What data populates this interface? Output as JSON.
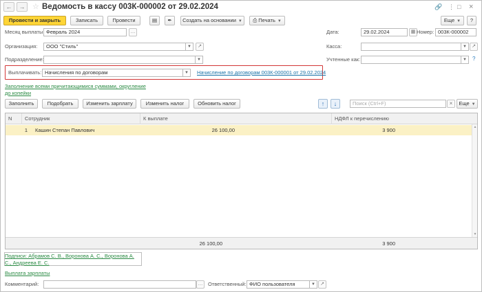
{
  "window": {
    "title": "Ведомость в кассу 003К-000002 от 29.02.2024"
  },
  "toolbar": {
    "post_close": "Провести и закрыть",
    "save": "Записать",
    "post": "Провести",
    "create_based": "Создать на основании",
    "print": "Печать",
    "more": "Еще"
  },
  "form": {
    "month_label": "Месяц выплаты:",
    "month_value": "Февраль 2024",
    "org_label": "Организация:",
    "org_value": "ООО \"Стиль\"",
    "dept_label": "Подразделение:",
    "dept_value": "",
    "pay_label": "Выплачивать:",
    "pay_value": "Начисления по договорам",
    "pay_link": "Начисление по договорам 003К-000001 от 29.02.2024",
    "date_label": "Дата:",
    "date_value": "29.02.2024",
    "number_label": "Номер:",
    "number_value": "003К-000002",
    "cash_label": "Касса:",
    "cash_value": "",
    "account_label": "Учтенные как:",
    "account_value": "",
    "fill_link": "Заполнение всеми причитающимися суммами, округление до копейки"
  },
  "table_toolbar": {
    "fill": "Заполнить",
    "select": "Подобрать",
    "change_salary": "Изменить зарплату",
    "change_tax": "Изменить налог",
    "update_tax": "Обновить налог",
    "search_placeholder": "Поиск (Ctrl+F)",
    "more": "Еще"
  },
  "table": {
    "columns": [
      "N",
      "Сотрудник",
      "К выплате",
      "НДФЛ к перечислению"
    ],
    "rows": [
      {
        "n": "1",
        "employee": "Кашин Степан Павлович",
        "to_pay": "26 100,00",
        "ndfl": "3 900"
      }
    ],
    "totals": {
      "to_pay": "26 100,00",
      "ndfl": "3 900"
    }
  },
  "footer": {
    "signatures": "Подписи: Абрамов С. В., Воронова А. С., Воронова А. С., Андреева Е. С.",
    "salary_payout": "Выплата зарплаты",
    "comment_label": "Комментарий:",
    "comment_value": "",
    "responsible_label": "Ответственный:",
    "responsible_value": "ФИО пользователя"
  },
  "colors": {
    "primary_button": "#ffd536",
    "selected_row": "#fbf1c5",
    "highlight_border": "#d23535",
    "link_green": "#2a8a43",
    "link_blue": "#1a73a8"
  }
}
